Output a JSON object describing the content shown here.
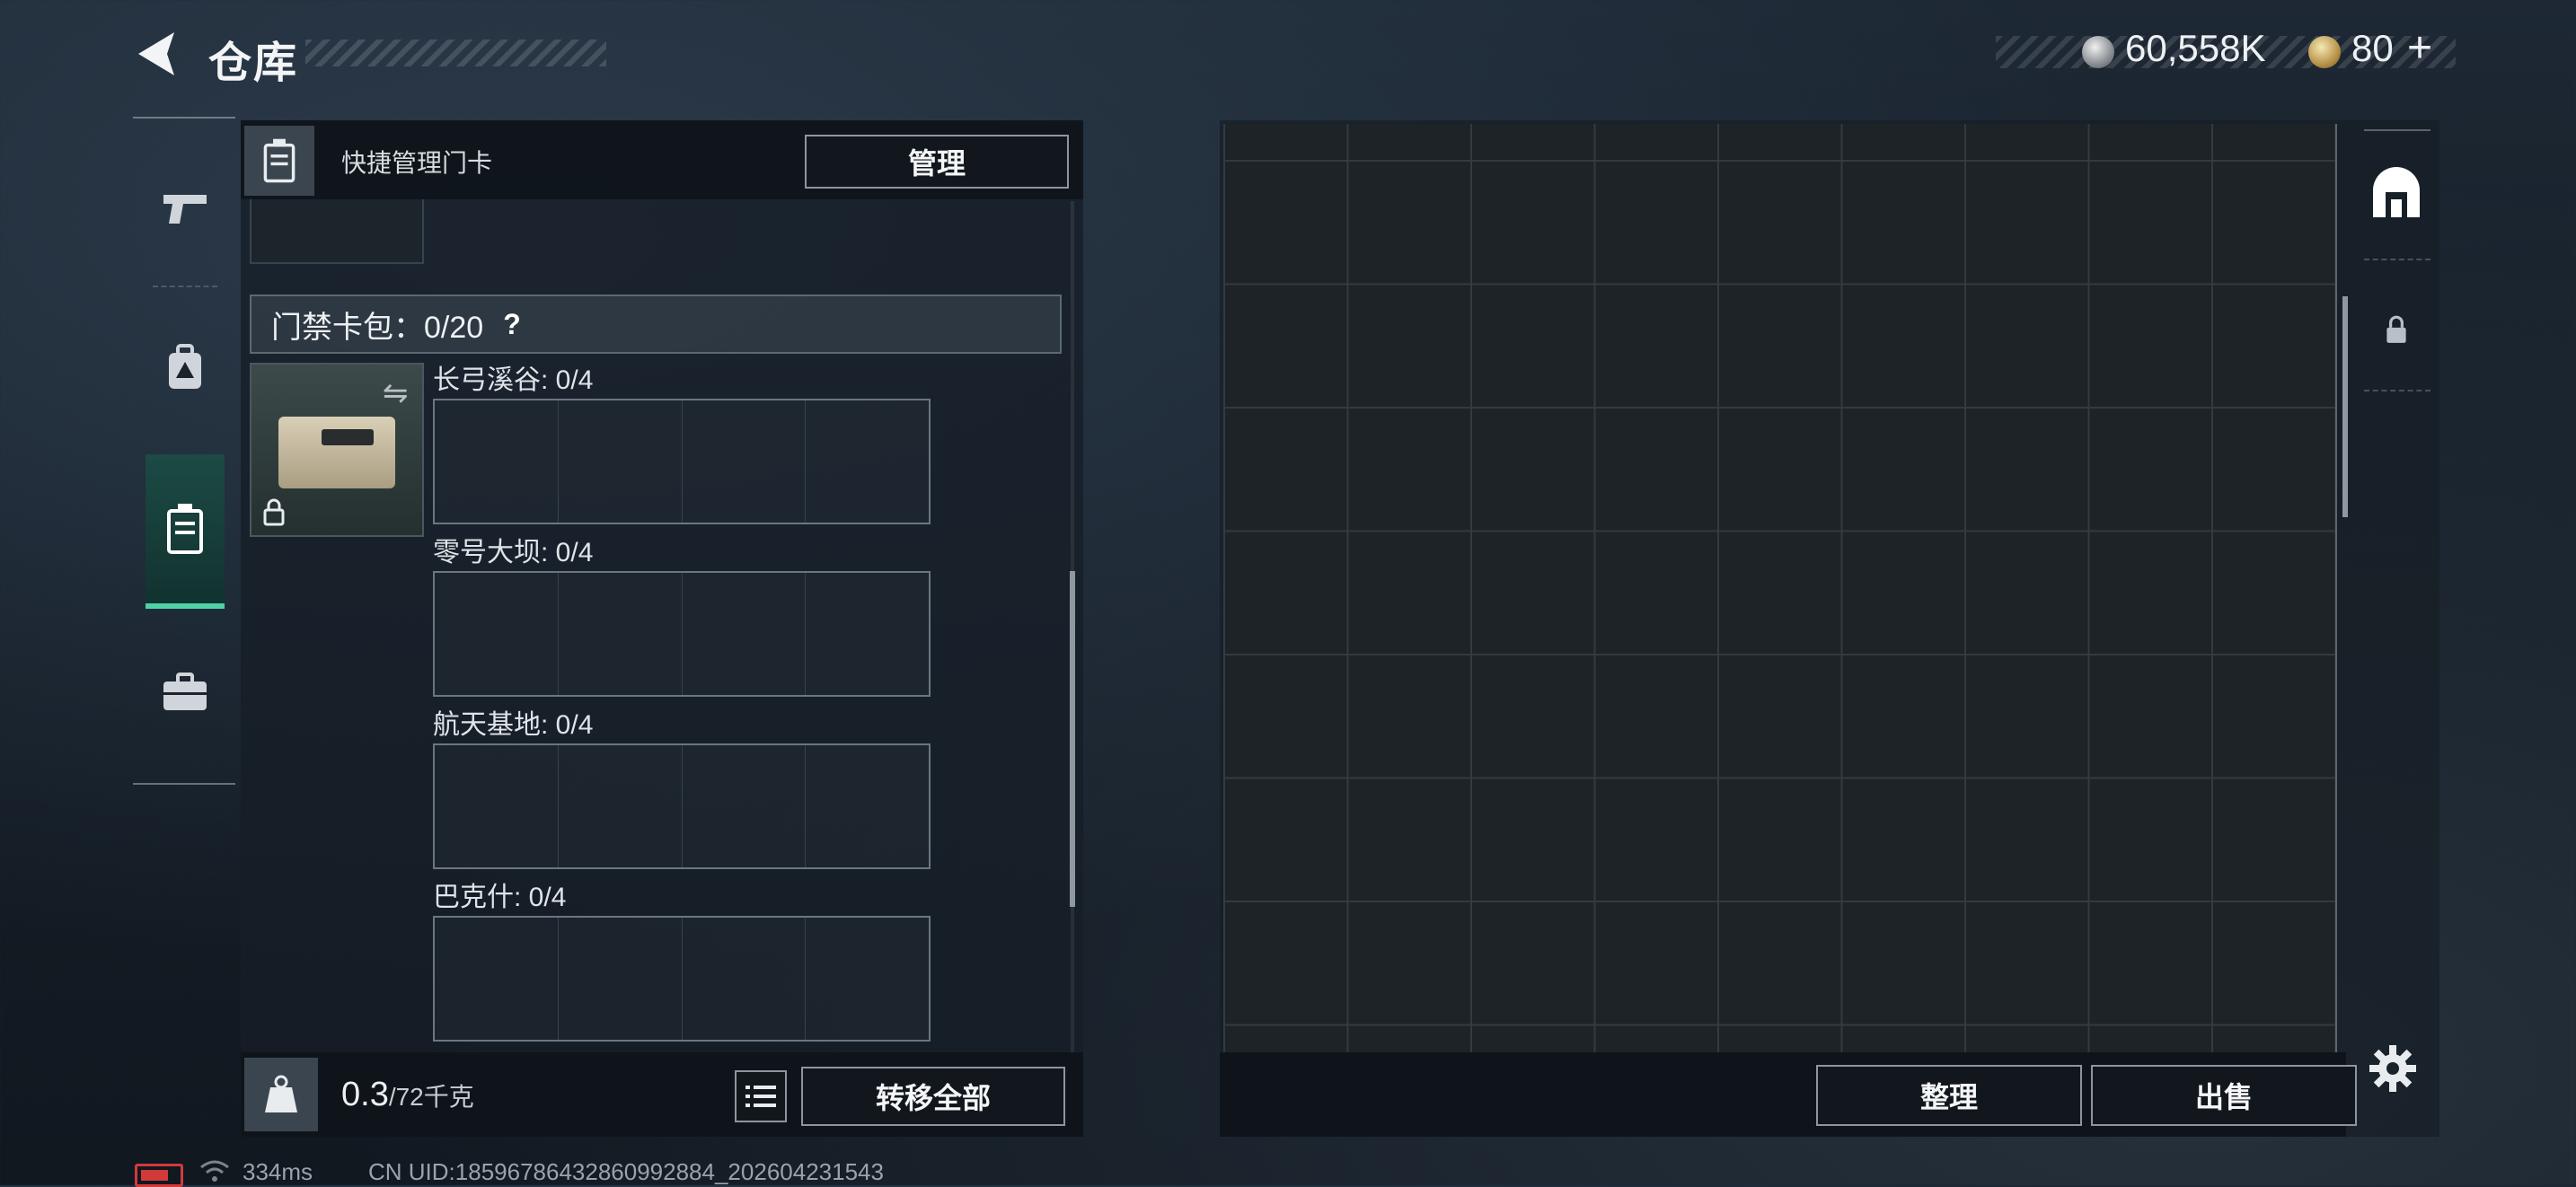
{
  "header": {
    "title": "仓库"
  },
  "currency": {
    "silver": "60,558K",
    "gold": "80",
    "plus": "+"
  },
  "left_panel": {
    "quick_manage_label": "快捷管理门卡",
    "manage_label": "管理",
    "keycard_bag": {
      "title": "门禁卡包：0/20",
      "help": "?"
    },
    "swap_glyph": "⇋",
    "maps": [
      {
        "label": "长弓溪谷: 0/4"
      },
      {
        "label": "零号大坝: 0/4"
      },
      {
        "label": "航天基地: 0/4"
      },
      {
        "label": "巴克什: 0/4"
      }
    ],
    "weight": {
      "current": "0.3",
      "max": "/72千克"
    },
    "transfer_all_label": "转移全部"
  },
  "right_panel": {
    "sort_label": "整理",
    "sell_label": "出售"
  },
  "status_bar": {
    "ping": "334ms",
    "uid": "CN UID:18596786432860992884_202604231543"
  },
  "icons": {
    "back": "back-arrow-icon",
    "tabs": [
      "pistol-icon",
      "backpack-icon",
      "keycard-case-icon",
      "briefcase-icon"
    ],
    "stash": "stash-icon",
    "lock": "lock-icon",
    "settings": "gear-icon"
  },
  "colors": {
    "accent": "#4fd1a6",
    "battery_low": "#d23a3a"
  }
}
